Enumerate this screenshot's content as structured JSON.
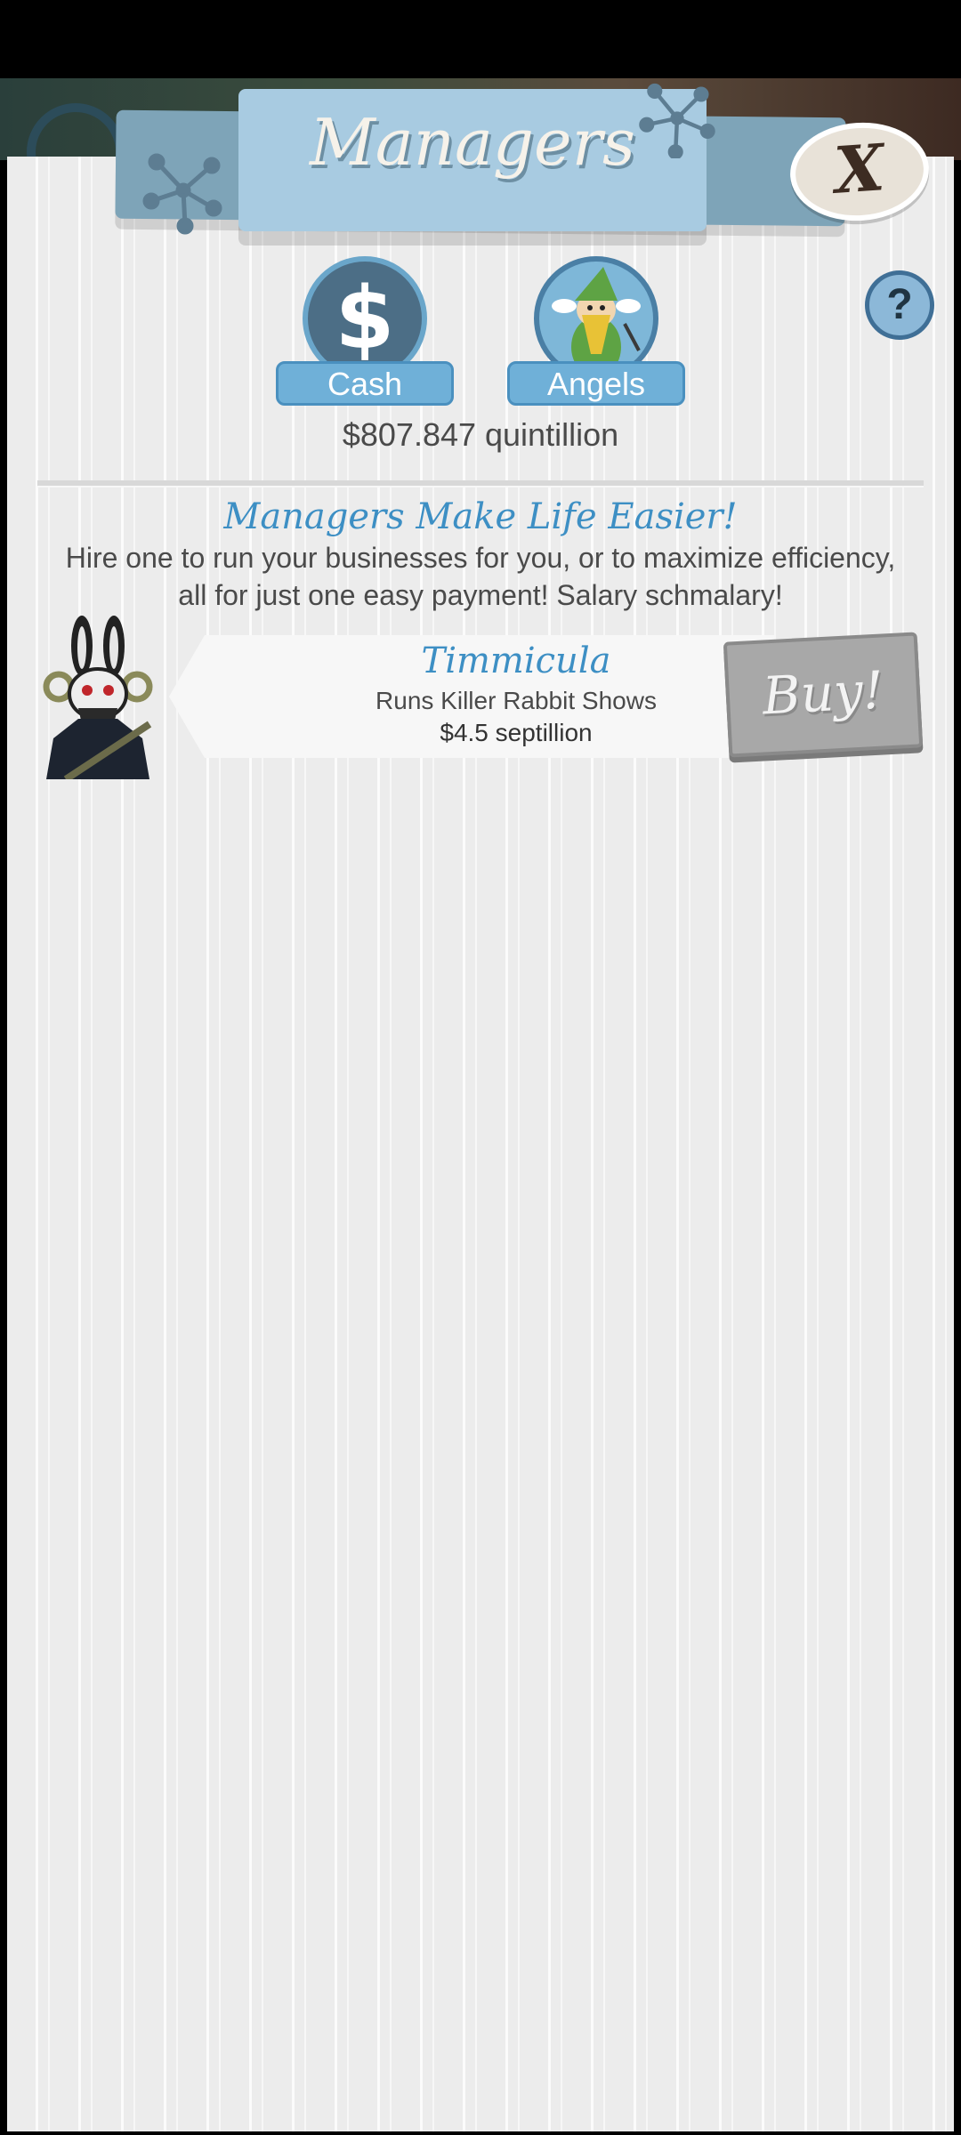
{
  "header": {
    "title": "Managers",
    "close_label": "X",
    "help_label": "?"
  },
  "tabs": [
    {
      "label": "Cash",
      "symbol": "$"
    },
    {
      "label": "Angels"
    }
  ],
  "cash_amount": "$807.847 quintillion",
  "intro": {
    "headline": "Managers Make Life Easier!",
    "body": "Hire one to run your businesses for you, or to maximize efficiency, all for just one easy payment! Salary schmalary!"
  },
  "managers": [
    {
      "name": "Timmicula",
      "description": "Runs Killer Rabbit Shows",
      "cost": "$4.5 septillion",
      "buy_label": "Buy!"
    }
  ],
  "colors": {
    "accent_blue": "#3d8fc4",
    "banner_blue": "#a8cbe1",
    "button_gray": "#a8a8a8",
    "panel_bg": "#ececec"
  }
}
